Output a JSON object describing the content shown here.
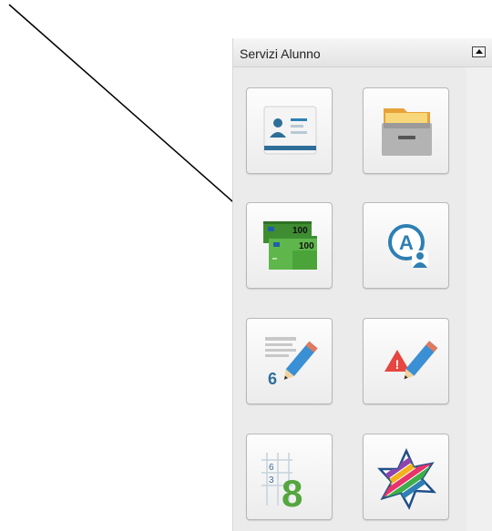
{
  "panel": {
    "title": "Servizi Alunno",
    "collapse_icon": "caret-up-icon"
  },
  "tiles": [
    {
      "icon": "student-id-card-icon"
    },
    {
      "icon": "file-cabinet-icon"
    },
    {
      "icon": "banknotes-payment-icon",
      "labels": [
        "100",
        "100"
      ]
    },
    {
      "icon": "absence-user-icon",
      "letter": "A"
    },
    {
      "icon": "grade-pencil-icon",
      "digit": "6"
    },
    {
      "icon": "warning-pencil-icon",
      "symbol": "!"
    },
    {
      "icon": "grade-grid-icon",
      "small": [
        "6",
        "3"
      ],
      "big": "8"
    },
    {
      "icon": "colorful-star-icon"
    }
  ],
  "colors": {
    "accent": "#2e7fb3",
    "alert": "#e5463f",
    "money": "#55a63f"
  }
}
